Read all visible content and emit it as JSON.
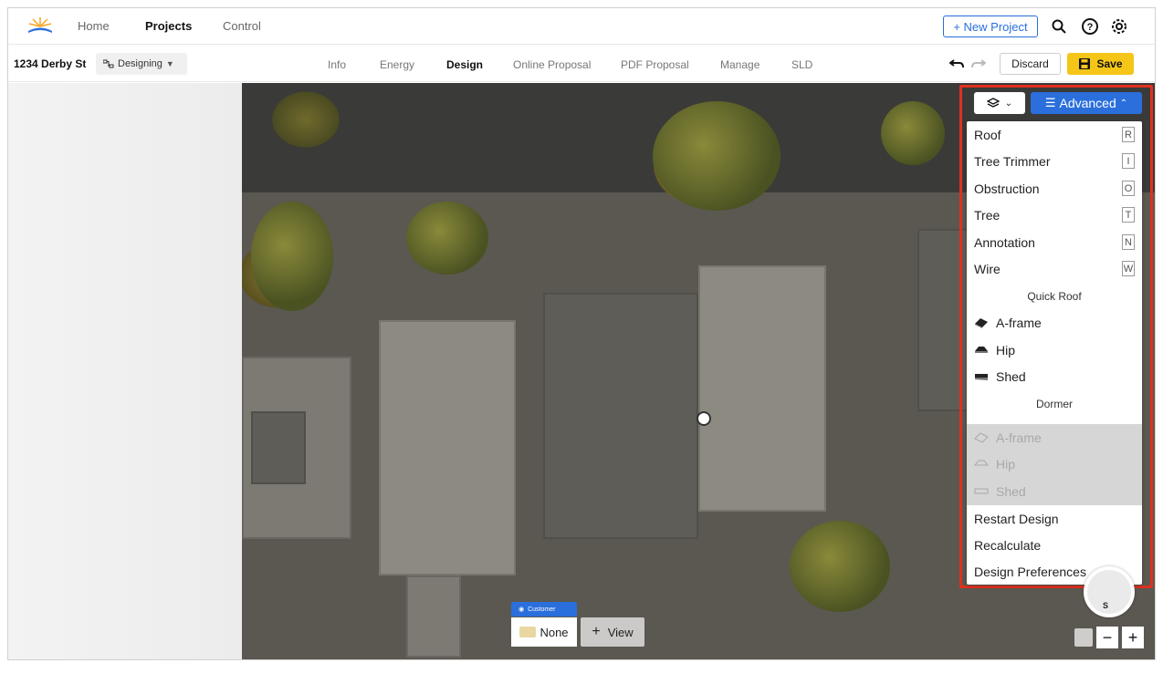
{
  "top_nav": {
    "items": [
      {
        "label": "Home"
      },
      {
        "label": "Projects"
      },
      {
        "label": "Control"
      }
    ],
    "new_project_label": "+ New Project"
  },
  "sub_bar": {
    "address": "1234 Derby St",
    "status": "Designing",
    "tabs": [
      {
        "label": "Info"
      },
      {
        "label": "Energy"
      },
      {
        "label": "Design"
      },
      {
        "label": "Online Proposal"
      },
      {
        "label": "PDF Proposal"
      },
      {
        "label": "Manage"
      },
      {
        "label": "SLD"
      }
    ],
    "active_tab": "Design",
    "discard_label": "Discard",
    "save_label": "Save"
  },
  "panel": {
    "advanced_label": "Advanced",
    "tools": [
      {
        "label": "Roof",
        "key": "R"
      },
      {
        "label": "Tree Trimmer",
        "key": "I"
      },
      {
        "label": "Obstruction",
        "key": "O"
      },
      {
        "label": "Tree",
        "key": "T"
      },
      {
        "label": "Annotation",
        "key": "N"
      },
      {
        "label": "Wire",
        "key": "W"
      }
    ],
    "quick_roof_heading": "Quick Roof",
    "quick_roof": [
      {
        "label": "A-frame"
      },
      {
        "label": "Hip"
      },
      {
        "label": "Shed"
      }
    ],
    "dormer_heading": "Dormer",
    "dormer": [
      {
        "label": "A-frame"
      },
      {
        "label": "Hip"
      },
      {
        "label": "Shed"
      }
    ],
    "actions": [
      {
        "label": "Restart Design"
      },
      {
        "label": "Recalculate"
      },
      {
        "label": "Design Preferences"
      }
    ]
  },
  "bottom_overlay": {
    "customer_tag": "Customer",
    "customer_value": "None",
    "view_label": "View"
  },
  "map_controls": {
    "compass_letter": "S",
    "zoom_out": "−",
    "zoom_in": "+"
  },
  "colors": {
    "accent_blue": "#2a6fdb",
    "save_yellow": "#f5c518",
    "highlight_red": "#e0301e"
  }
}
